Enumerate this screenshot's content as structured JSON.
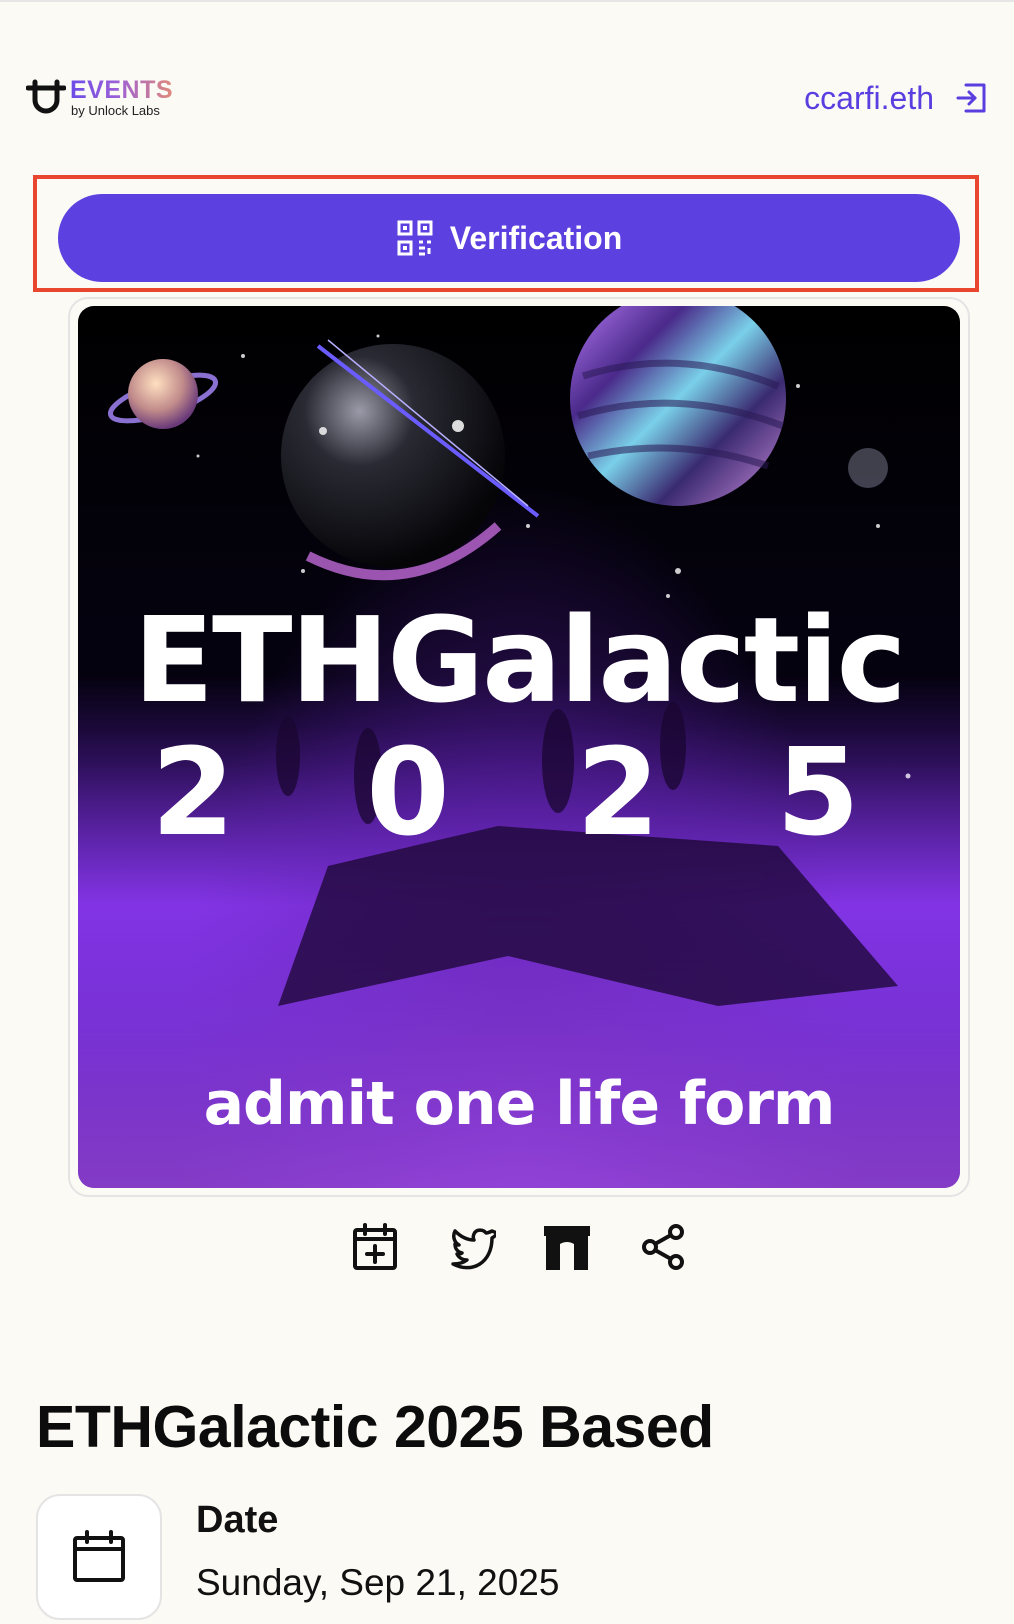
{
  "header": {
    "logo_title": "EVENTS",
    "logo_subtitle": "by Unlock Labs",
    "account_name": "ccarfi.eth"
  },
  "verification": {
    "label": "Verification"
  },
  "cover": {
    "headline": "ETHGalactic",
    "year_digits": [
      "2",
      "0",
      "2",
      "5"
    ],
    "tagline": "admit one life form"
  },
  "share_icons": [
    "calendar-plus-icon",
    "twitter-icon",
    "opensea-icon",
    "share-icon"
  ],
  "event": {
    "title": "ETHGalactic 2025 Based",
    "date_label": "Date",
    "date_value": "Sunday, Sep 21, 2025"
  },
  "colors": {
    "accent": "#5c41e0",
    "highlight": "#e8462e",
    "background": "#fbfaf5"
  }
}
